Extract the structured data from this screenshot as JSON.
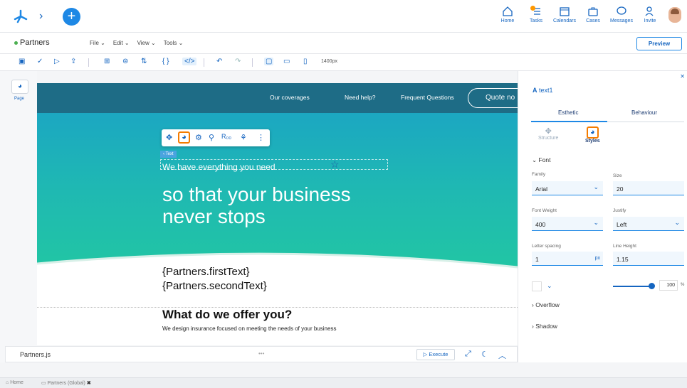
{
  "header": {
    "nav": [
      {
        "label": "Home",
        "icon": "home-icon"
      },
      {
        "label": "Tasks",
        "icon": "tasks-icon"
      },
      {
        "label": "Calendars",
        "icon": "calendar-icon"
      },
      {
        "label": "Cases",
        "icon": "briefcase-icon"
      },
      {
        "label": "Messages",
        "icon": "chat-icon"
      },
      {
        "label": "Invite",
        "icon": "add-user-icon"
      }
    ]
  },
  "menubar": {
    "process_name": "Partners",
    "menus": [
      "File",
      "Edit",
      "View",
      "Tools"
    ],
    "preview_label": "Preview"
  },
  "toolbar": {
    "width_label": "1400px"
  },
  "leftstrip": {
    "page_label": "Page"
  },
  "canvas": {
    "nav_links": [
      "Our coverages",
      "Need help?",
      "Frequent Questions"
    ],
    "quote_button": "Quote no",
    "element_tag": "Text",
    "text1": "We have everything you need",
    "headline_line1": "so that your business",
    "headline_line2": "never stops",
    "template_first": "{Partners.firstText}",
    "template_second": "{Partners.secondText}",
    "offer_title": "What do we offer you?",
    "offer_subtitle": "We design insurance focused on meeting the needs of your business"
  },
  "bottombar": {
    "file_name": "Partners.js",
    "dots": "•••",
    "execute_label": "Execute"
  },
  "panel": {
    "element_title": "text1",
    "tabs": [
      "Esthetic",
      "Behaviour"
    ],
    "subtabs": [
      "Structure",
      "Styles"
    ],
    "font_section": "Font",
    "family_label": "Family",
    "family_value": "Arial",
    "size_label": "Size",
    "size_value": "20",
    "weight_label": "Font Weight",
    "weight_value": "400",
    "justify_label": "Justify",
    "justify_value": "Left",
    "letter_label": "Letter spacing",
    "letter_value": "1",
    "letter_unit": "px",
    "line_label": "Line Height",
    "line_value": "1.15",
    "opacity_value": "100",
    "opacity_unit": "%",
    "opacity_level": 1.0,
    "overflow_section": "Overflow",
    "shadow_section": "Shadow"
  },
  "footer": {
    "home": "Home",
    "tab": "Partners (Global)"
  }
}
